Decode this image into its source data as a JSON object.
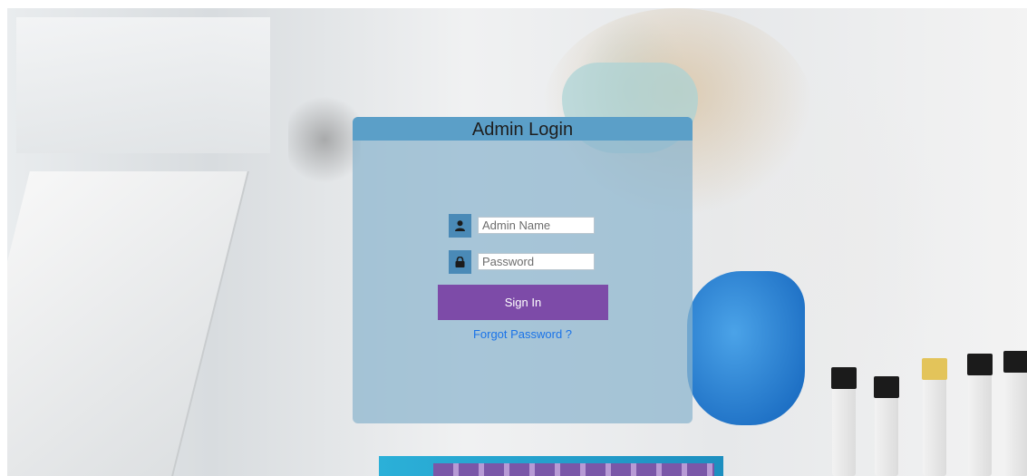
{
  "login": {
    "title": "Admin Login",
    "username": {
      "placeholder": "Admin Name",
      "value": "",
      "icon": "user-icon"
    },
    "password": {
      "placeholder": "Password",
      "value": "",
      "icon": "lock-icon"
    },
    "submit_label": "Sign In",
    "forgot_label": "Forgot Password ?"
  },
  "colors": {
    "header": "#5b9fc8",
    "card": "#8ab4cd",
    "icon_box": "#4a8ab7",
    "button": "#7d4ba8",
    "link": "#1a73e8"
  }
}
